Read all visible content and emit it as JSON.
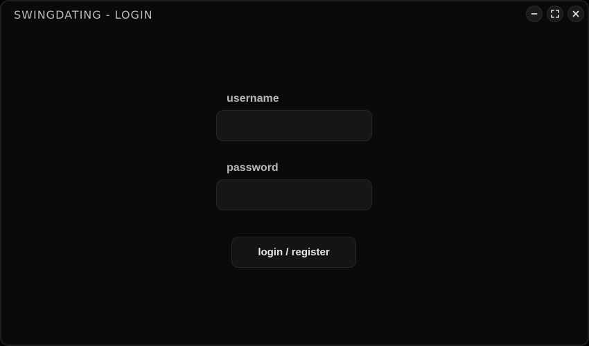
{
  "window": {
    "title": "SWINGDATING - LOGIN",
    "controls": {
      "minimize_icon": "minus-icon",
      "maximize_icon": "maximize-icon",
      "close_icon": "close-icon"
    }
  },
  "form": {
    "username": {
      "label": "username",
      "value": "",
      "placeholder": ""
    },
    "password": {
      "label": "password",
      "value": "",
      "placeholder": ""
    },
    "submit_label": "login / register"
  },
  "colors": {
    "background": "#0a0a0a",
    "field_background": "#161616",
    "text": "#b9b9b9"
  }
}
